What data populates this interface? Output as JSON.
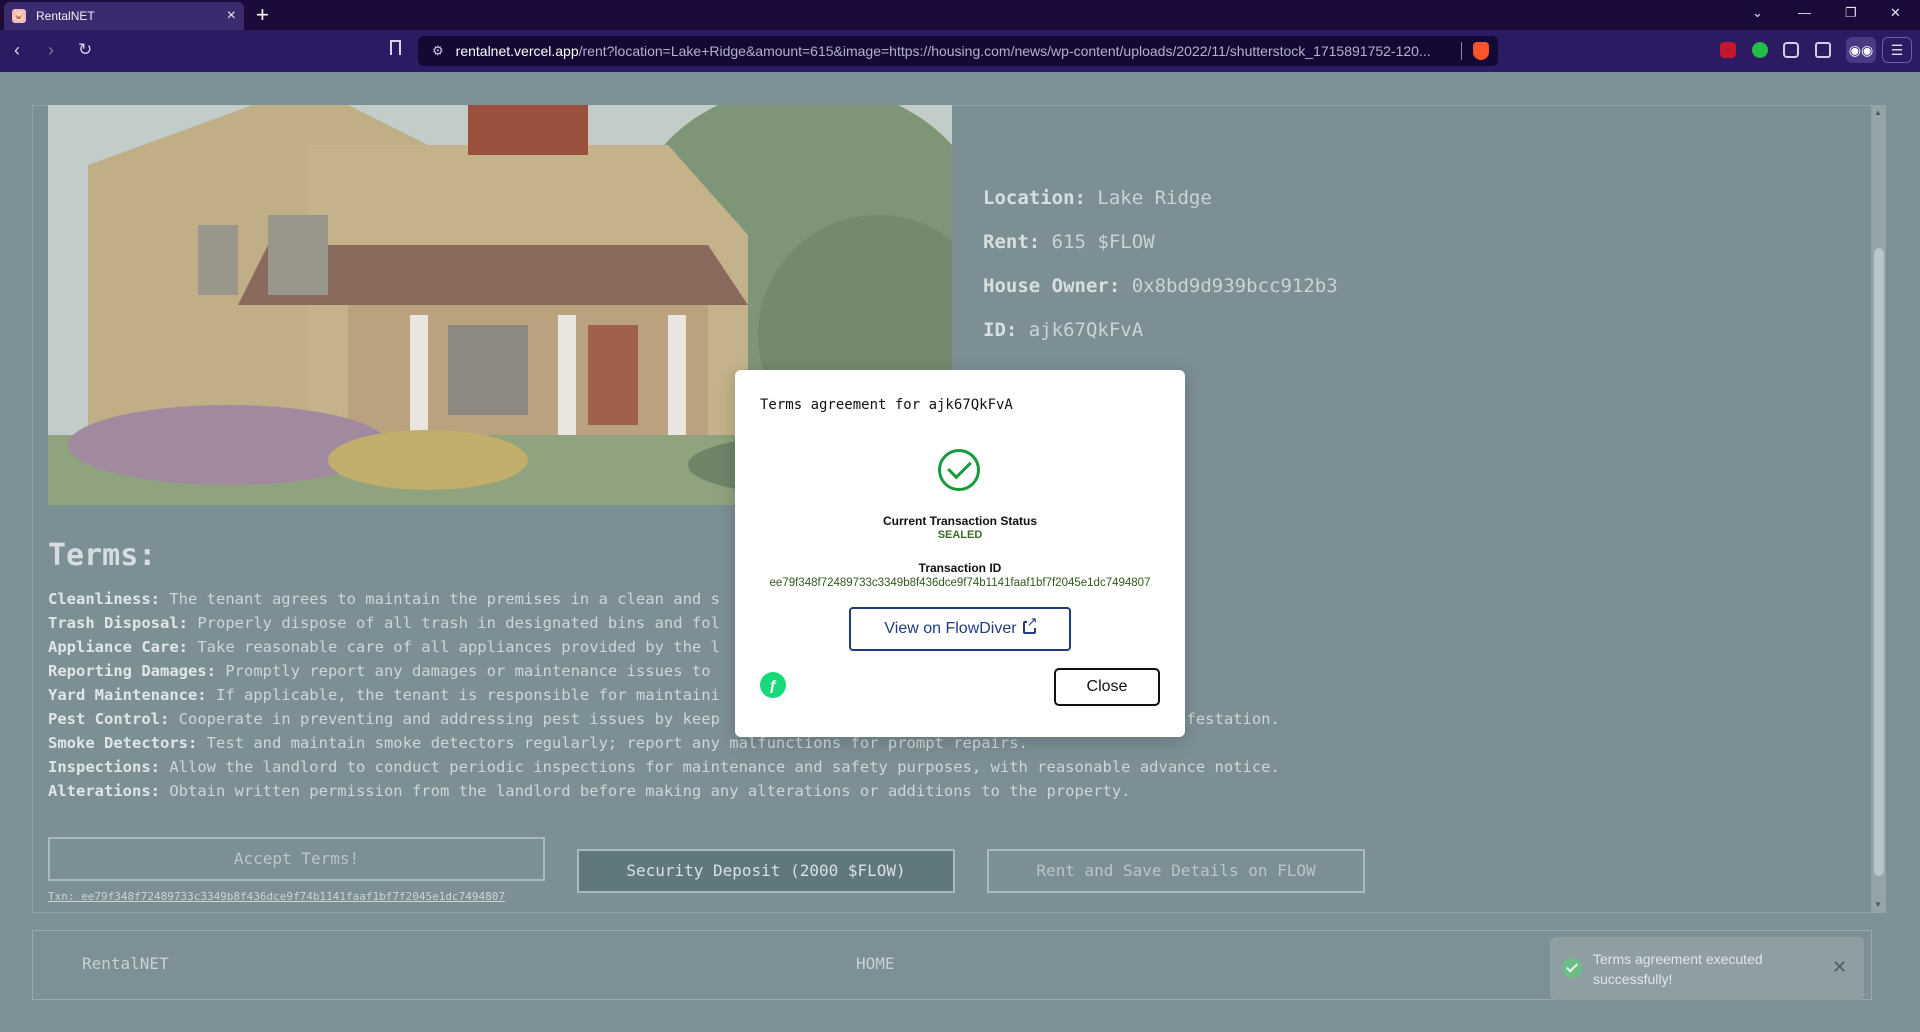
{
  "browser": {
    "tab_title": "RentalNET",
    "url_host": "rentalnet.vercel.app",
    "url_path": "/rent?location=Lake+Ridge&amount=615&image=https://housing.com/news/wp-content/uploads/2022/11/shutterstock_1715891752-120..."
  },
  "house": {
    "location_label": "Location:",
    "location_value": "Lake Ridge",
    "rent_label": "Rent:",
    "rent_value": "615 $FLOW",
    "owner_label": "House Owner:",
    "owner_value": "0x8bd9d939bcc912b3",
    "id_label": "ID:",
    "id_value": "ajk67QkFvA"
  },
  "terms": {
    "heading": "Terms:",
    "items": [
      {
        "key": "Cleanliness:",
        "text": "The tenant agrees to maintain the premises in a clean and s"
      },
      {
        "key": "Trash Disposal:",
        "text": "Properly dispose of all trash in designated bins and fol"
      },
      {
        "key": "Appliance Care:",
        "text": "Take reasonable care of all appliances provided by the l"
      },
      {
        "key": "Reporting Damages:",
        "text": "Promptly report any damages or maintenance issues to"
      },
      {
        "key": "Yard Maintenance:",
        "text": "If applicable, the tenant is responsible for maintaini                                 the agreement."
      },
      {
        "key": "Pest Control:",
        "text": "Cooperate in preventing and addressing pest issues by keep                                   any signs of infestation."
      },
      {
        "key": "Smoke Detectors:",
        "text": "Test and maintain smoke detectors regularly; report any malfunctions for prompt repairs."
      },
      {
        "key": "Inspections:",
        "text": "Allow the landlord to conduct periodic inspections for maintenance and safety purposes, with reasonable advance notice."
      },
      {
        "key": "Alterations:",
        "text": "Obtain written permission from the landlord before making any alterations or additions to the property."
      }
    ]
  },
  "actions": {
    "accept_label": "Accept Terms!",
    "deposit_label": "Security Deposit (2000 $FLOW)",
    "rent_save_label": "Rent and Save Details on FLOW",
    "txn_link": "Txn: ee79f348f72489733c3349b8f436dce9f74b1141faaf1bf7f2045e1dc7494807"
  },
  "footer": {
    "brand": "RentalNET",
    "home": "HOME"
  },
  "modal": {
    "title": "Terms agreement for ajk67QkFvA",
    "status_label": "Current Transaction Status",
    "status_value": "SEALED",
    "txid_label": "Transaction ID",
    "txid_value": "ee79f348f72489733c3349b8f436dce9f74b1141faaf1bf7f2045e1dc7494807",
    "flowdiver_label": "View on FlowDiver",
    "close_label": "Close"
  },
  "toast": {
    "message": "Terms agreement executed successfully!"
  },
  "colors": {
    "status_success": "#199a3b",
    "flow_green": "#16d97a",
    "link_blue": "#1e3c80"
  }
}
